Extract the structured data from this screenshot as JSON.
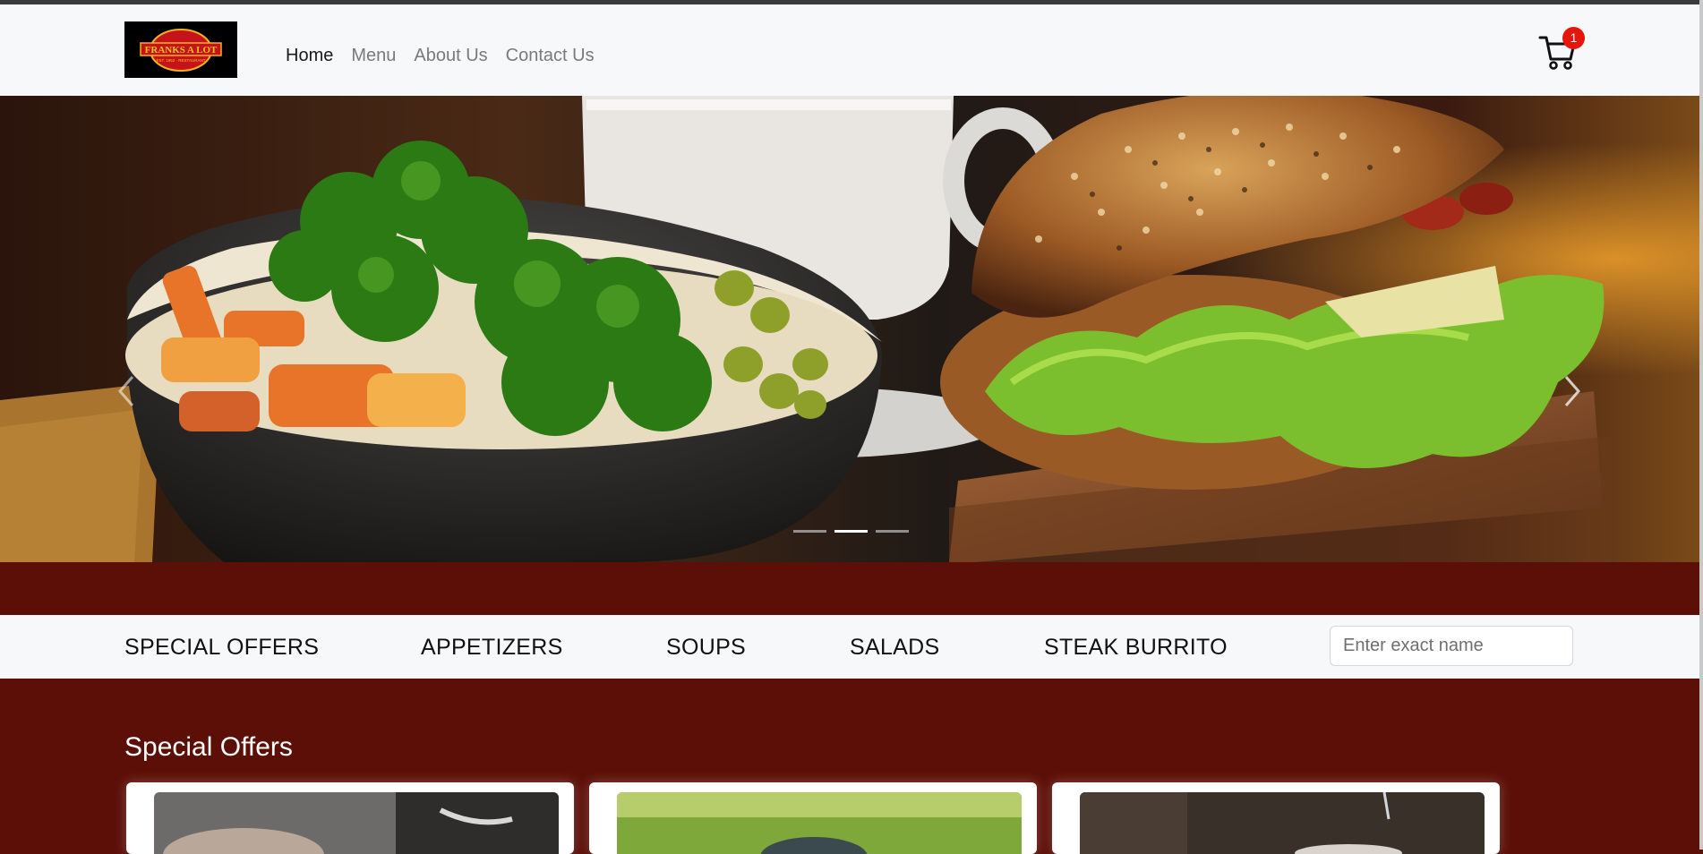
{
  "brand": {
    "logo_text": "FRANKS A LOT",
    "logo_subtext": "EST. 1952 · RESTAURANT"
  },
  "nav": {
    "links": [
      {
        "label": "Home",
        "active": true
      },
      {
        "label": "Menu",
        "active": false
      },
      {
        "label": "About Us",
        "active": false
      },
      {
        "label": "Contact Us",
        "active": false
      }
    ]
  },
  "cart": {
    "icon": "shopping-cart-icon",
    "count": "1"
  },
  "hero": {
    "prev_icon": "chevron-left-icon",
    "next_icon": "chevron-right-icon",
    "slide_count": 3,
    "active_slide": 2
  },
  "categories": {
    "items": [
      "SPECIAL OFFERS",
      "APPETIZERS",
      "SOUPS",
      "SALADS",
      "STEAK BURRITO"
    ],
    "search_placeholder": "Enter exact name"
  },
  "special_offers": {
    "title": "Special Offers",
    "card_count": 3
  },
  "colors": {
    "maroon": "#5c0f07",
    "nav_bg": "#f7f8fa",
    "badge_red": "#e5170d"
  }
}
